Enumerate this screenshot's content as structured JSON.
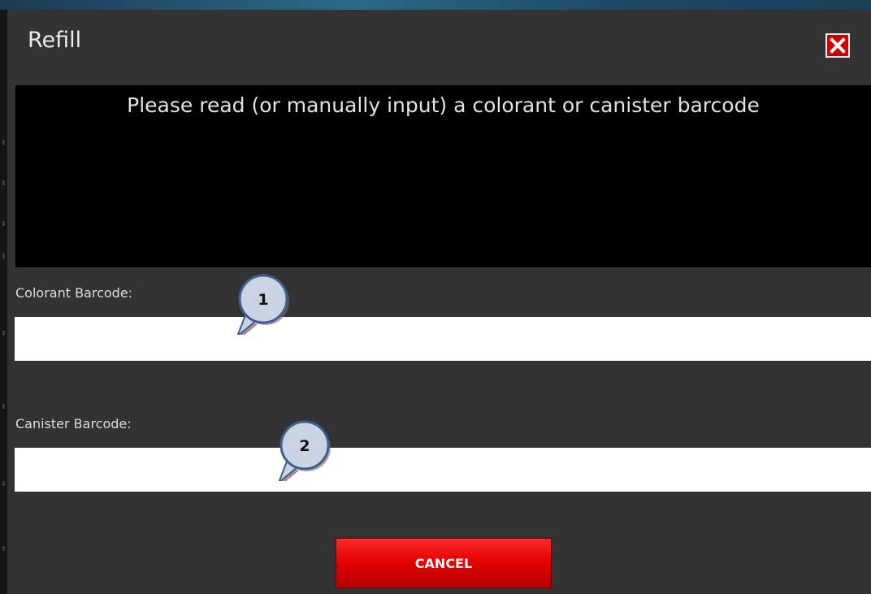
{
  "dialog": {
    "title": "Refill",
    "close_icon": "close-icon"
  },
  "message": {
    "text": "Please read (or manually input) a colorant or canister barcode"
  },
  "colorant": {
    "label": "Colorant Barcode:",
    "value": ""
  },
  "canister": {
    "label": "Canister Barcode:",
    "value": ""
  },
  "actions": {
    "cancel_label": "CANCEL"
  },
  "callouts": [
    {
      "number": "1"
    },
    {
      "number": "2"
    }
  ],
  "colors": {
    "dialog_bg": "#333333",
    "message_bg": "#000000",
    "cancel_red": "#e00000",
    "close_red": "#d10000",
    "callout_fill": "#c9d3e2",
    "callout_outline": "#3d5f8f"
  }
}
